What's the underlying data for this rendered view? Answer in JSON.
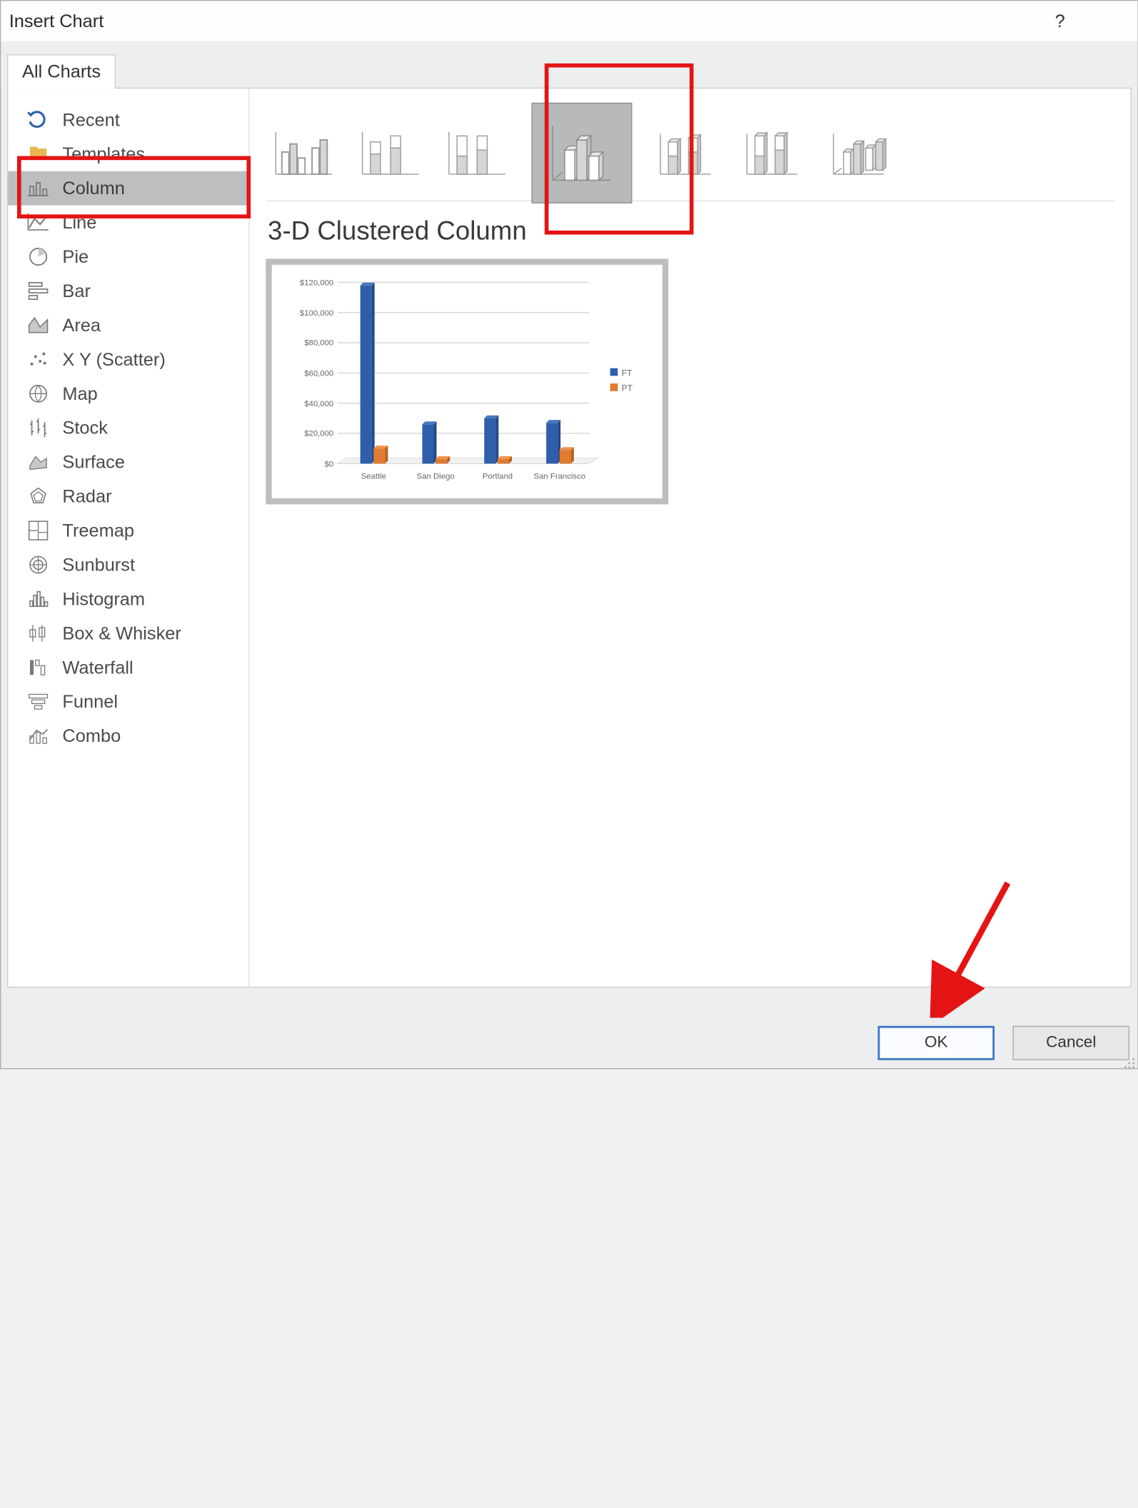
{
  "window": {
    "title": "Insert Chart"
  },
  "tab_label": "All Charts",
  "sidebar": {
    "items": [
      {
        "label": "Recent",
        "icon": "recent"
      },
      {
        "label": "Templates",
        "icon": "templates"
      },
      {
        "label": "Column",
        "icon": "column",
        "selected": true
      },
      {
        "label": "Line",
        "icon": "line"
      },
      {
        "label": "Pie",
        "icon": "pie"
      },
      {
        "label": "Bar",
        "icon": "bar"
      },
      {
        "label": "Area",
        "icon": "area"
      },
      {
        "label": "X Y (Scatter)",
        "icon": "scatter"
      },
      {
        "label": "Map",
        "icon": "map"
      },
      {
        "label": "Stock",
        "icon": "stock"
      },
      {
        "label": "Surface",
        "icon": "surface"
      },
      {
        "label": "Radar",
        "icon": "radar"
      },
      {
        "label": "Treemap",
        "icon": "treemap"
      },
      {
        "label": "Sunburst",
        "icon": "sunburst"
      },
      {
        "label": "Histogram",
        "icon": "histogram"
      },
      {
        "label": "Box & Whisker",
        "icon": "box"
      },
      {
        "label": "Waterfall",
        "icon": "waterfall"
      },
      {
        "label": "Funnel",
        "icon": "funnel"
      },
      {
        "label": "Combo",
        "icon": "combo"
      }
    ]
  },
  "subtypes": [
    {
      "name": "clustered-column"
    },
    {
      "name": "stacked-column"
    },
    {
      "name": "100-stacked-column"
    },
    {
      "name": "3d-clustered-column",
      "selected": true
    },
    {
      "name": "3d-stacked-column"
    },
    {
      "name": "3d-100-stacked-column"
    },
    {
      "name": "3d-column"
    }
  ],
  "chart_heading": "3-D Clustered Column",
  "legend": {
    "series1": "FT",
    "series2": "PT"
  },
  "buttons": {
    "ok": "OK",
    "cancel": "Cancel"
  },
  "colors": {
    "series1": "#2f5fab",
    "series2": "#e07b2f",
    "grid": "#d5d5d5",
    "axis": "#888"
  },
  "chart_data": {
    "type": "bar",
    "title": "",
    "xlabel": "",
    "ylabel": "",
    "ylim": [
      0,
      120000
    ],
    "y_ticks": [
      "$0",
      "$20,000",
      "$40,000",
      "$60,000",
      "$80,000",
      "$100,000",
      "$120,000"
    ],
    "categories": [
      "Seattle",
      "San Diego",
      "Portland",
      "San Francisco"
    ],
    "series": [
      {
        "name": "FT",
        "values": [
          118000,
          26000,
          30000,
          27000
        ]
      },
      {
        "name": "PT",
        "values": [
          10000,
          3000,
          3000,
          9000
        ]
      }
    ],
    "legend_position": "right"
  }
}
